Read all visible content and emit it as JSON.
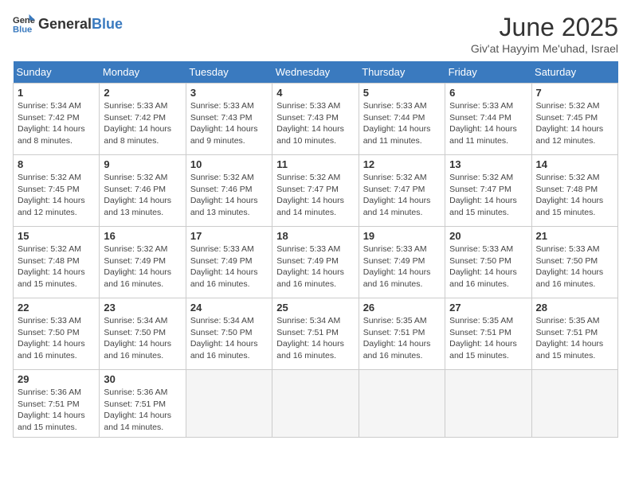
{
  "logo": {
    "general": "General",
    "blue": "Blue",
    "tagline": "GeneralBlue"
  },
  "title": "June 2025",
  "subtitle": "Giv'at Hayyim Me'uhad, Israel",
  "days_of_week": [
    "Sunday",
    "Monday",
    "Tuesday",
    "Wednesday",
    "Thursday",
    "Friday",
    "Saturday"
  ],
  "weeks": [
    [
      {
        "day": 1,
        "sunrise": "5:34 AM",
        "sunset": "7:42 PM",
        "daylight": "14 hours and 8 minutes."
      },
      {
        "day": 2,
        "sunrise": "5:33 AM",
        "sunset": "7:42 PM",
        "daylight": "14 hours and 8 minutes."
      },
      {
        "day": 3,
        "sunrise": "5:33 AM",
        "sunset": "7:43 PM",
        "daylight": "14 hours and 9 minutes."
      },
      {
        "day": 4,
        "sunrise": "5:33 AM",
        "sunset": "7:43 PM",
        "daylight": "14 hours and 10 minutes."
      },
      {
        "day": 5,
        "sunrise": "5:33 AM",
        "sunset": "7:44 PM",
        "daylight": "14 hours and 11 minutes."
      },
      {
        "day": 6,
        "sunrise": "5:33 AM",
        "sunset": "7:44 PM",
        "daylight": "14 hours and 11 minutes."
      },
      {
        "day": 7,
        "sunrise": "5:32 AM",
        "sunset": "7:45 PM",
        "daylight": "14 hours and 12 minutes."
      }
    ],
    [
      {
        "day": 8,
        "sunrise": "5:32 AM",
        "sunset": "7:45 PM",
        "daylight": "14 hours and 12 minutes."
      },
      {
        "day": 9,
        "sunrise": "5:32 AM",
        "sunset": "7:46 PM",
        "daylight": "14 hours and 13 minutes."
      },
      {
        "day": 10,
        "sunrise": "5:32 AM",
        "sunset": "7:46 PM",
        "daylight": "14 hours and 13 minutes."
      },
      {
        "day": 11,
        "sunrise": "5:32 AM",
        "sunset": "7:47 PM",
        "daylight": "14 hours and 14 minutes."
      },
      {
        "day": 12,
        "sunrise": "5:32 AM",
        "sunset": "7:47 PM",
        "daylight": "14 hours and 14 minutes."
      },
      {
        "day": 13,
        "sunrise": "5:32 AM",
        "sunset": "7:47 PM",
        "daylight": "14 hours and 15 minutes."
      },
      {
        "day": 14,
        "sunrise": "5:32 AM",
        "sunset": "7:48 PM",
        "daylight": "14 hours and 15 minutes."
      }
    ],
    [
      {
        "day": 15,
        "sunrise": "5:32 AM",
        "sunset": "7:48 PM",
        "daylight": "14 hours and 15 minutes."
      },
      {
        "day": 16,
        "sunrise": "5:32 AM",
        "sunset": "7:49 PM",
        "daylight": "14 hours and 16 minutes."
      },
      {
        "day": 17,
        "sunrise": "5:33 AM",
        "sunset": "7:49 PM",
        "daylight": "14 hours and 16 minutes."
      },
      {
        "day": 18,
        "sunrise": "5:33 AM",
        "sunset": "7:49 PM",
        "daylight": "14 hours and 16 minutes."
      },
      {
        "day": 19,
        "sunrise": "5:33 AM",
        "sunset": "7:49 PM",
        "daylight": "14 hours and 16 minutes."
      },
      {
        "day": 20,
        "sunrise": "5:33 AM",
        "sunset": "7:50 PM",
        "daylight": "14 hours and 16 minutes."
      },
      {
        "day": 21,
        "sunrise": "5:33 AM",
        "sunset": "7:50 PM",
        "daylight": "14 hours and 16 minutes."
      }
    ],
    [
      {
        "day": 22,
        "sunrise": "5:33 AM",
        "sunset": "7:50 PM",
        "daylight": "14 hours and 16 minutes."
      },
      {
        "day": 23,
        "sunrise": "5:34 AM",
        "sunset": "7:50 PM",
        "daylight": "14 hours and 16 minutes."
      },
      {
        "day": 24,
        "sunrise": "5:34 AM",
        "sunset": "7:50 PM",
        "daylight": "14 hours and 16 minutes."
      },
      {
        "day": 25,
        "sunrise": "5:34 AM",
        "sunset": "7:51 PM",
        "daylight": "14 hours and 16 minutes."
      },
      {
        "day": 26,
        "sunrise": "5:35 AM",
        "sunset": "7:51 PM",
        "daylight": "14 hours and 16 minutes."
      },
      {
        "day": 27,
        "sunrise": "5:35 AM",
        "sunset": "7:51 PM",
        "daylight": "14 hours and 15 minutes."
      },
      {
        "day": 28,
        "sunrise": "5:35 AM",
        "sunset": "7:51 PM",
        "daylight": "14 hours and 15 minutes."
      }
    ],
    [
      {
        "day": 29,
        "sunrise": "5:36 AM",
        "sunset": "7:51 PM",
        "daylight": "14 hours and 15 minutes."
      },
      {
        "day": 30,
        "sunrise": "5:36 AM",
        "sunset": "7:51 PM",
        "daylight": "14 hours and 14 minutes."
      },
      null,
      null,
      null,
      null,
      null
    ]
  ]
}
